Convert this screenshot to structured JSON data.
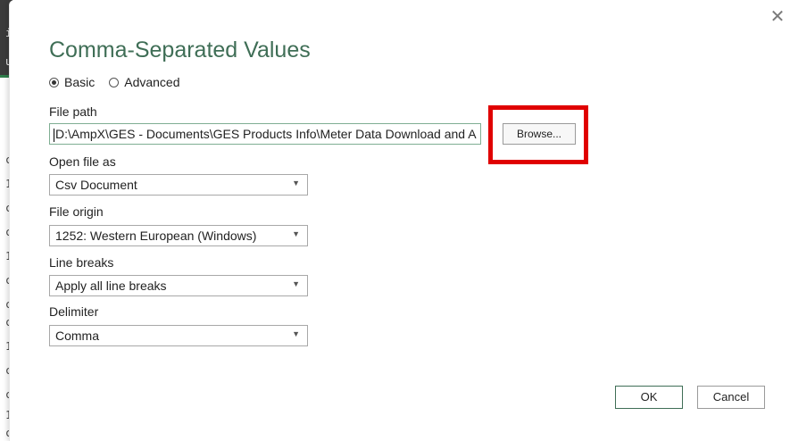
{
  "dialog": {
    "title": "Comma-Separated Values",
    "close_icon": "close-icon",
    "mode": {
      "options": [
        {
          "label": "Basic",
          "selected": true
        },
        {
          "label": "Advanced",
          "selected": false
        }
      ]
    },
    "file_path": {
      "label": "File path",
      "value": "D:\\AmpX\\GES - Documents\\GES Products Info\\Meter Data Download and A",
      "browse_label": "Browse..."
    },
    "open_file_as": {
      "label": "Open file as",
      "value": "Csv Document"
    },
    "file_origin": {
      "label": "File origin",
      "value": "1252: Western European (Windows)"
    },
    "line_breaks": {
      "label": "Line breaks",
      "value": "Apply all line breaks"
    },
    "delimiter": {
      "label": "Delimiter",
      "value": "Comma"
    },
    "buttons": {
      "ok": "OK",
      "cancel": "Cancel"
    }
  },
  "background": {
    "edge_chars": [
      "i",
      "u",
      "c",
      "1",
      "c",
      "c",
      "1",
      "c",
      "c",
      "c",
      "1",
      "c",
      "c",
      "1",
      "c"
    ]
  },
  "colors": {
    "title": "#3f6e56",
    "highlight": "#e00000",
    "input_border": "#7fae93"
  }
}
